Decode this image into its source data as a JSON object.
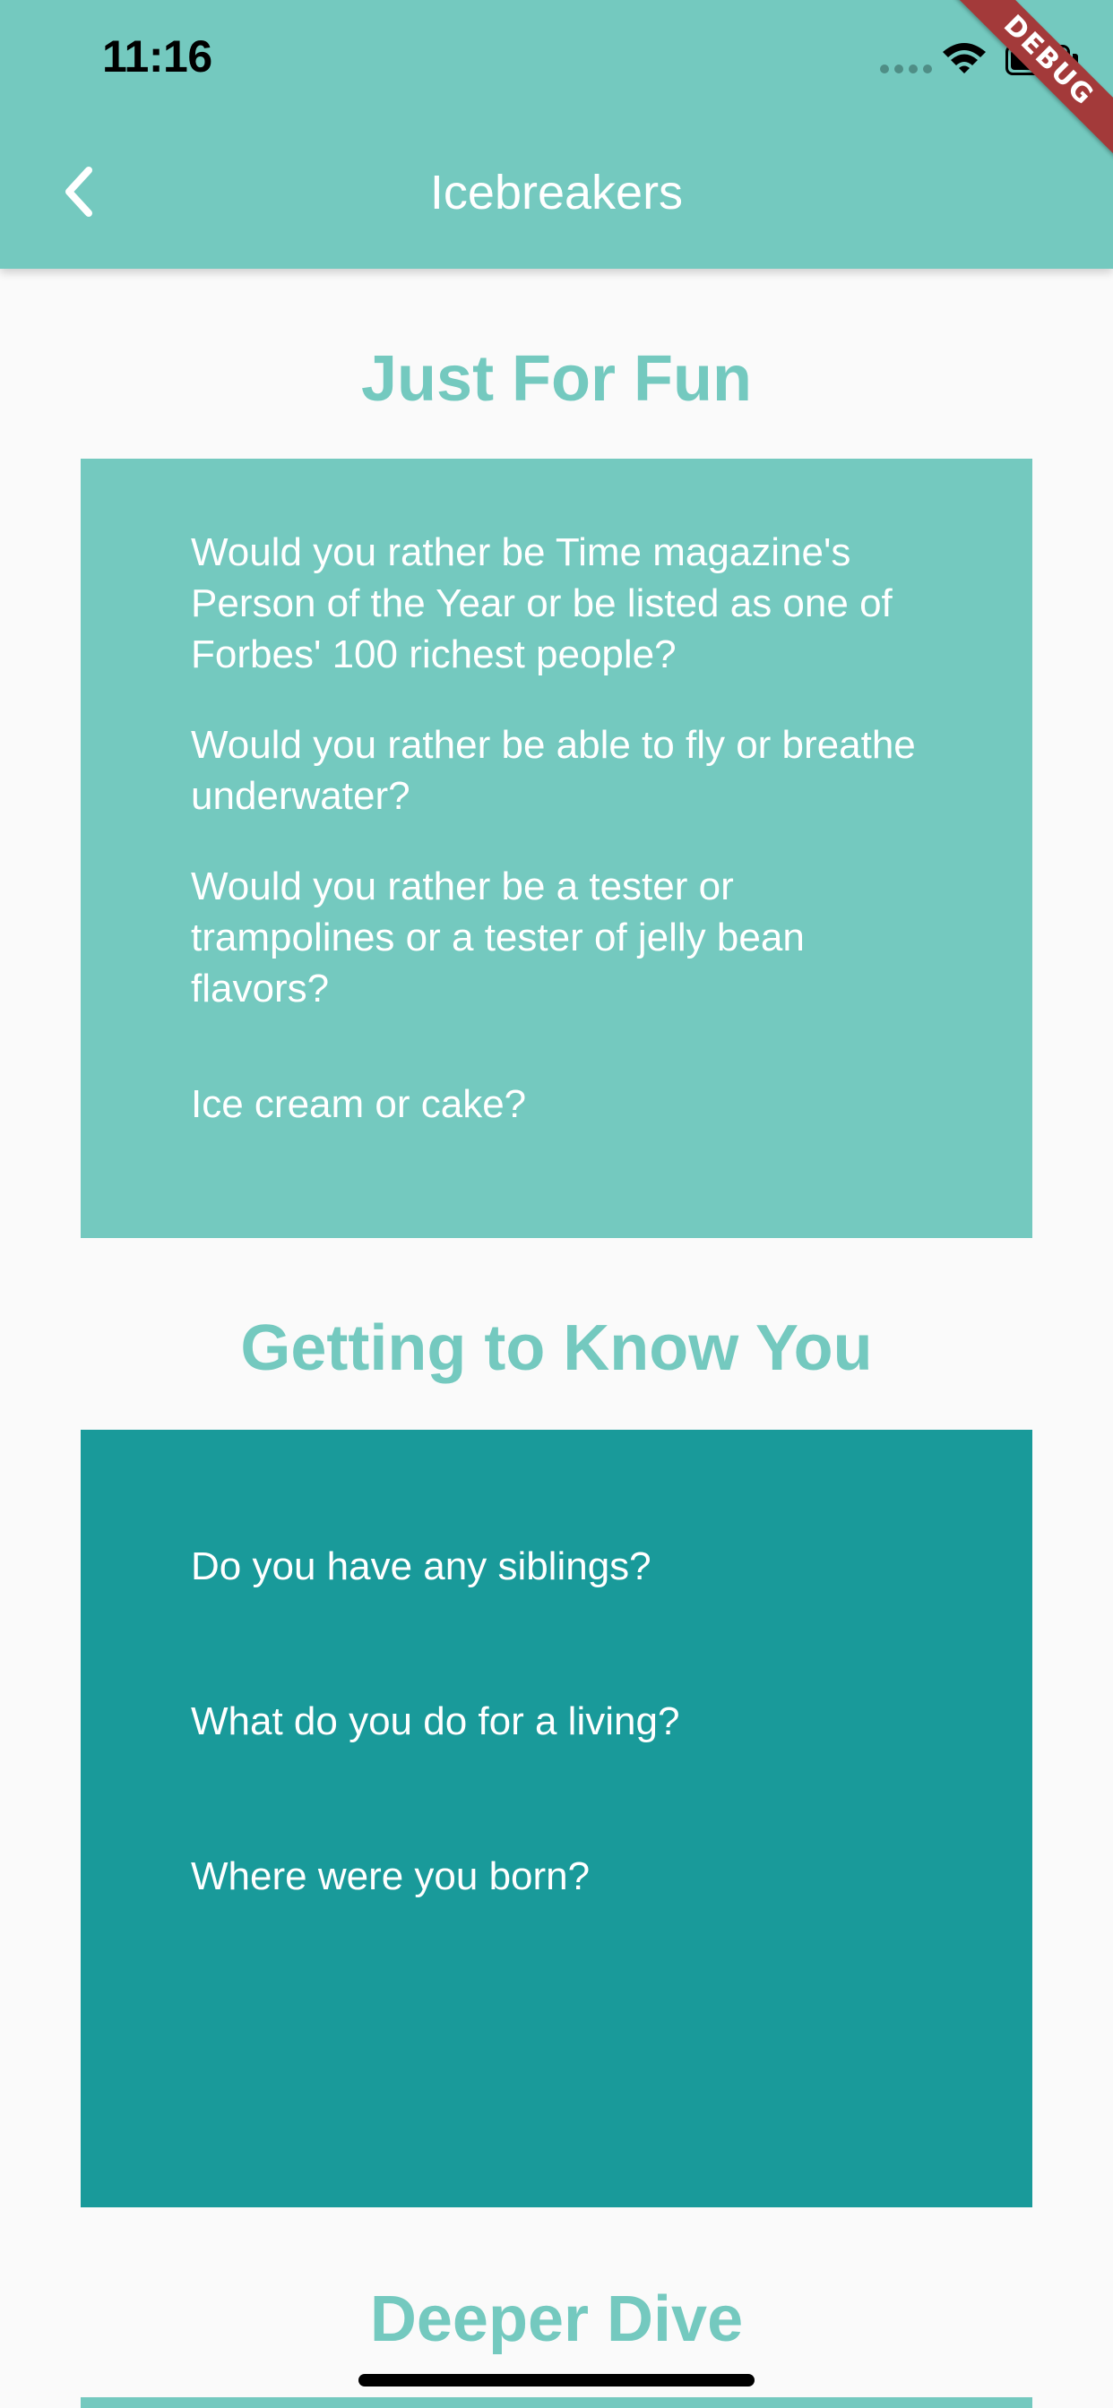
{
  "status_bar": {
    "time": "11:16"
  },
  "debug_banner": {
    "label": "DEBUG"
  },
  "nav": {
    "title": "Icebreakers",
    "back_icon": "chevron-left-icon"
  },
  "sections": [
    {
      "title": "Just For Fun",
      "color": "#74C9BF",
      "questions": [
        "Would you rather be Time magazine's Person of the Year or be listed as one of Forbes' 100 richest people?",
        "Would you rather be able to fly or breathe underwater?",
        "Would you rather be a tester or trampolines or a tester of jelly bean flavors?",
        "Ice cream or cake?"
      ]
    },
    {
      "title": "Getting to Know You",
      "color": "#199A9A",
      "questions": [
        "Do you have any siblings?",
        "What do you do for a living?",
        "Where were you born?"
      ]
    },
    {
      "title": "Deeper Dive",
      "color": "#74C9BF",
      "questions": []
    }
  ],
  "colors": {
    "primary": "#74C9BF",
    "secondary": "#199A9A",
    "background": "#FAFAFA"
  }
}
